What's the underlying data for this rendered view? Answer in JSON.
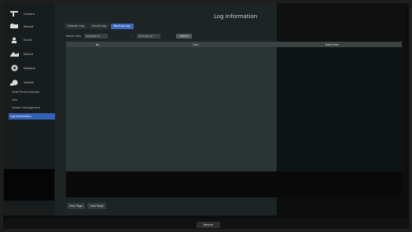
{
  "page": {
    "title": "Log Information"
  },
  "sidebar": {
    "items": [
      {
        "label": "Camera",
        "icon": "camera-icon"
      },
      {
        "label": "Record",
        "icon": "record-icon"
      },
      {
        "label": "Event",
        "icon": "event-icon"
      },
      {
        "label": "Device",
        "icon": "device-icon"
      },
      {
        "label": "Network",
        "icon": "network-icon"
      },
      {
        "label": "System",
        "icon": "system-icon"
      }
    ],
    "subitems": [
      {
        "label": "Date/Time/Language"
      },
      {
        "label": "User"
      },
      {
        "label": "System Management"
      },
      {
        "label": "Log Information",
        "active": true
      }
    ]
  },
  "tabs": [
    {
      "label": "System Log"
    },
    {
      "label": "Event Log"
    },
    {
      "label": "Backup Log",
      "active": true
    }
  ],
  "search": {
    "label": "Search Day",
    "from": "2019-08-19",
    "to": "2019-08-19",
    "button": "Search"
  },
  "table": {
    "columns": [
      "No",
      "User",
      "Date/Time"
    ]
  },
  "paging": {
    "first": "First Page",
    "last": "Last Page"
  },
  "footer": {
    "return": "Return"
  },
  "colors": {
    "accent": "#3461b8",
    "background": "#1d2424"
  }
}
